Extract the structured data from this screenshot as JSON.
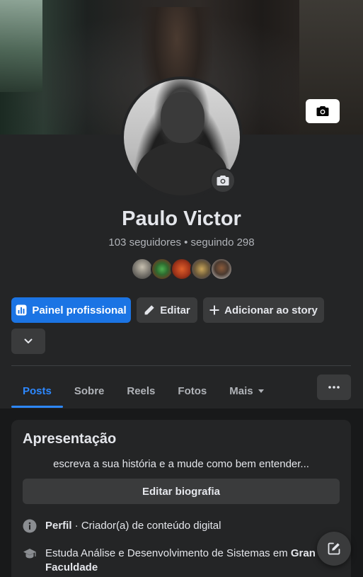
{
  "profile": {
    "name": "Paulo Victor",
    "followers_line": "103 seguidores • seguindo 298",
    "friends_preview": [
      "friend-1",
      "friend-2",
      "friend-3",
      "friend-4",
      "friend-5"
    ]
  },
  "actions": {
    "painel": "Painel profissional",
    "editar": "Editar",
    "story": "Adicionar ao story"
  },
  "tabs": [
    {
      "label": "Posts",
      "active": true
    },
    {
      "label": "Sobre"
    },
    {
      "label": "Reels"
    },
    {
      "label": "Fotos"
    },
    {
      "label": "Mais"
    }
  ],
  "intro": {
    "title": "Apresentação",
    "bio": "escreva a sua história e a mude como bem entender...",
    "edit_bio_label": "Editar biografia",
    "perfil_label": "Perfil",
    "perfil_text": " · Criador(a) de conteúdo digital",
    "study_text": "Estuda Análise e Desenvolvimento de Sistemas em ",
    "study_school": "Gran Faculdade"
  },
  "colors": {
    "accent": "#1b74e4",
    "active_tab": "#2d88ff",
    "background": "#18191a",
    "surface": "#242526",
    "button": "#3a3b3c"
  },
  "icons": [
    "camera-icon",
    "dashboard-icon",
    "pencil-icon",
    "plus-icon",
    "chevron-down-icon",
    "ellipsis-icon",
    "info-icon",
    "graduation-cap-icon",
    "compose-icon"
  ]
}
